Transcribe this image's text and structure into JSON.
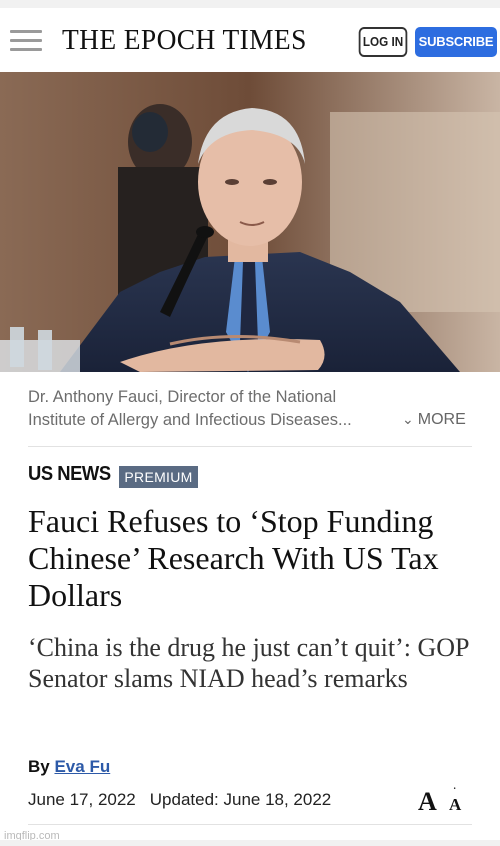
{
  "header": {
    "logo_text": "THE EPOCH TIMES",
    "login_label": "LOG IN",
    "subscribe_label": "SUBSCRIBE",
    "menu_icon": "hamburger-menu-icon"
  },
  "photo": {
    "caption_line1": "Dr. Anthony Fauci, Director of the National",
    "caption_line2": "Institute of Allergy and Infectious Diseases...",
    "more_label": "MORE",
    "more_icon": "chevron-down-icon"
  },
  "article": {
    "section": "US NEWS",
    "badge": "PREMIUM",
    "headline": "Fauci Refuses to ‘Stop Funding Chinese’ Research With US Tax Dollars",
    "subheadline": "‘China is the drug he just can’t quit’: GOP Senator slams NIAD head’s remarks",
    "by_label": "By",
    "author": "Eva Fu",
    "published": "June 17, 2022",
    "updated": "Updated: June 18, 2022",
    "font_size_big": "A",
    "font_size_small": "A"
  },
  "watermark": "imgflip.com",
  "colors": {
    "subscribe_blue": "#2d6de0",
    "premium_badge": "#5a6b83",
    "author_link": "#2d5aa8"
  }
}
